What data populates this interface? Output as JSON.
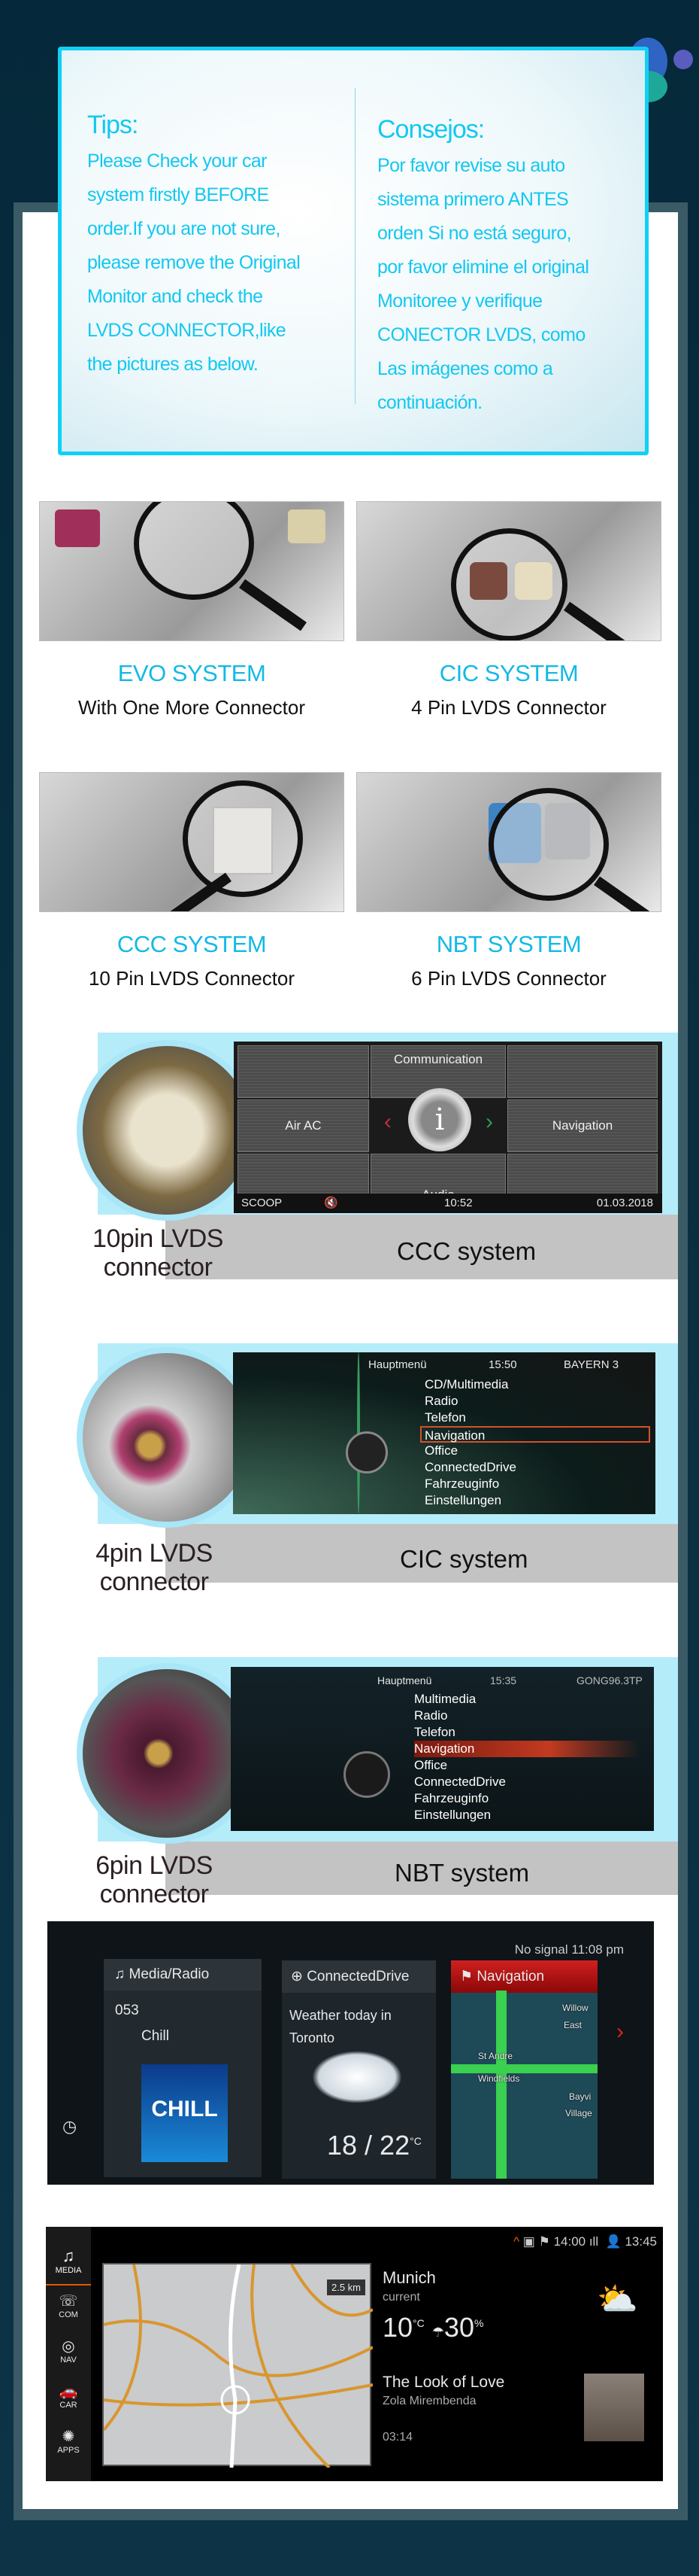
{
  "tips": {
    "en_title": "Tips:",
    "en_lines": [
      "Please Check your car",
      "system firstly BEFORE",
      "order.If you are not sure,",
      "please remove the Original",
      "Monitor and check the",
      "LVDS CONNECTOR,like",
      "the pictures as below."
    ],
    "es_title": "Consejos:",
    "es_lines": [
      "Por favor revise su auto",
      "sistema primero ANTES",
      "orden Si no está seguro,",
      "por favor elimine el original",
      "Monitoree y verifique",
      "CONECTOR LVDS, como",
      "Las imágenes como a",
      "continuación."
    ]
  },
  "systems": [
    {
      "title": "EVO SYSTEM",
      "subtitle": "With One More Connector"
    },
    {
      "title": "CIC SYSTEM",
      "subtitle": "4 Pin LVDS Connector"
    },
    {
      "title": "CCC SYSTEM",
      "subtitle": "10 Pin LVDS Connector"
    },
    {
      "title": "NBT SYSTEM",
      "subtitle": "6 Pin LVDS Connector"
    }
  ],
  "ccc": {
    "connector_label": [
      "10pin LVDS",
      "connector"
    ],
    "system_label": "CCC system",
    "screen": {
      "top": "Communication",
      "left": "Air AC",
      "right": "Navigation",
      "bottom": "Audio",
      "center": "i",
      "status_source": "SCOOP",
      "time": "10:52",
      "date": "01.03.2018"
    }
  },
  "cic": {
    "connector_label": [
      "4pin LVDS",
      "connector"
    ],
    "system_label": "CIC system",
    "screen": {
      "header": "Hauptmenü",
      "time": "15:50",
      "station": "BAYERN 3",
      "items": [
        "CD/Multimedia",
        "Radio",
        "Telefon",
        "Navigation",
        "Office",
        "ConnectedDrive",
        "Fahrzeuginfo",
        "Einstellungen"
      ],
      "selected": "Navigation"
    }
  },
  "nbt": {
    "connector_label": [
      "6pin LVDS",
      "connector"
    ],
    "system_label": "NBT system",
    "screen": {
      "header": "Hauptmenü",
      "time": "15:35",
      "station": "GONG96.3",
      "tp": "TP",
      "items": [
        "Multimedia",
        "Radio",
        "Telefon",
        "Navigation",
        "Office",
        "ConnectedDrive",
        "Fahrzeuginfo",
        "Einstellungen"
      ],
      "selected": "Navigation"
    }
  },
  "evo_screen": {
    "status": "No signal 11:08 pm",
    "tiles": [
      {
        "title": "Media/Radio",
        "channel": "053",
        "name": "Chill",
        "art": "CHILL"
      },
      {
        "title": "ConnectedDrive",
        "text": "Weather today in Toronto",
        "temp": "18 / 22",
        "unit": "°C"
      },
      {
        "title": "Navigation",
        "places": [
          "Willow",
          "East",
          "St Andre",
          "Windfields",
          "Bayvi",
          "Village"
        ]
      }
    ]
  },
  "id_screen": {
    "status_time": "14:00",
    "clock": "13:45",
    "sidebar": [
      "MEDIA",
      "COM",
      "NAV",
      "CAR",
      "APPS"
    ],
    "distance": "2.5 km",
    "weather": {
      "city": "Munich",
      "sub": "current",
      "temp": "10",
      "temp_unit": "°C",
      "rain": "30",
      "rain_unit": "%"
    },
    "music": {
      "title": "The Look of Love",
      "artist": "Zola Mirembenda",
      "time": "03:14"
    }
  },
  "colors": {
    "accent": "#13c8f0",
    "frame": "#3a5b66",
    "background": "#05293a"
  }
}
